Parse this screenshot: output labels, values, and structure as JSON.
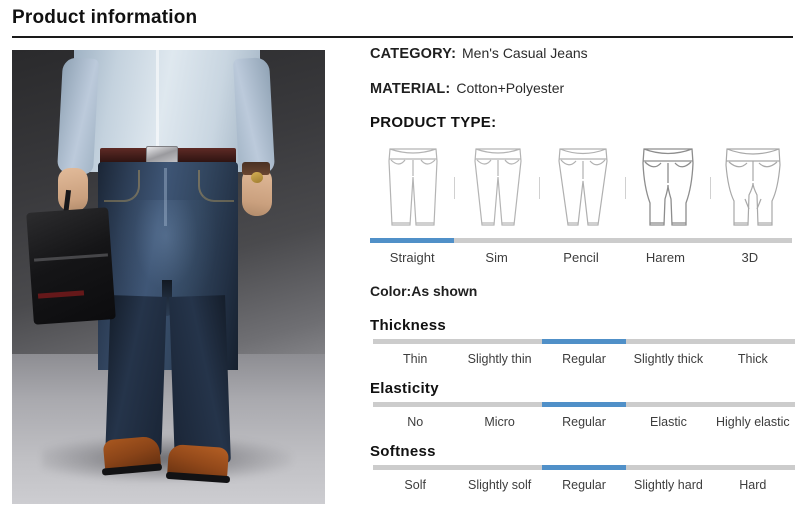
{
  "header": {
    "title": "Product information"
  },
  "specs": [
    {
      "label": "CATEGORY:",
      "value": "Men's Casual  Jeans"
    },
    {
      "label": "MATERIAL:",
      "value": "Cotton+Polyester"
    }
  ],
  "product_type": {
    "heading": "PRODUCT TYPE:",
    "options": [
      {
        "label": "Straight",
        "icon": "straight-pants-icon"
      },
      {
        "label": "Sim",
        "icon": "slim-pants-icon"
      },
      {
        "label": "Pencil",
        "icon": "pencil-pants-icon"
      },
      {
        "label": "Harem",
        "icon": "harem-pants-icon"
      },
      {
        "label": "3D",
        "icon": "3d-pants-icon"
      }
    ],
    "selected_index": 0
  },
  "color": {
    "text": "Color:As shown"
  },
  "attributes": [
    {
      "heading": "Thickness",
      "options": [
        "Thin",
        "Slightly thin",
        "Regular",
        "Slightly thick",
        "Thick"
      ],
      "selected_index": 2
    },
    {
      "heading": "Elasticity",
      "options": [
        "No",
        "Micro",
        "Regular",
        "Elastic",
        "Highly elastic"
      ],
      "selected_index": 2
    },
    {
      "heading": "Softness",
      "options": [
        "Solf",
        "Slightly solf",
        "Regular",
        "Slightly hard",
        "Hard"
      ],
      "selected_index": 2
    }
  ],
  "photo": {
    "alt": "man-wearing-jeans-photo"
  },
  "colors": {
    "accent": "#5090c8",
    "track": "#cccccc",
    "rule": "#1a1a1a",
    "text": "#1f1f1f"
  }
}
